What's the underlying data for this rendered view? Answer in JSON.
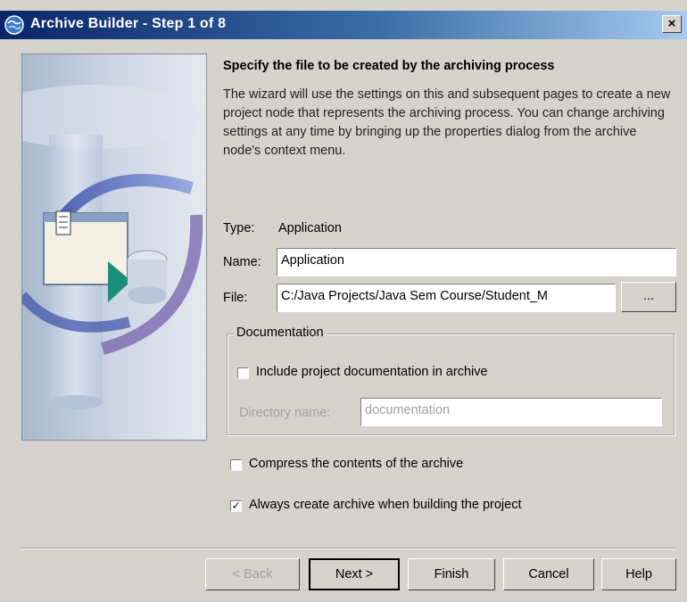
{
  "window": {
    "title": "Archive Builder - Step 1 of 8",
    "icon": "app-globe-icon",
    "close_symbol": "×"
  },
  "content": {
    "heading": "Specify the file to be created by the archiving process",
    "description": "The wizard will use the settings on this and subsequent pages to create a new project node that represents the archiving process. You can change archiving settings at any time by bringing up the properties dialog from the archive node's context menu."
  },
  "form": {
    "type_label": "Type:",
    "type_value": "Application",
    "name_label": "Name:",
    "name_value": "Application",
    "file_label": "File:",
    "file_value": "C:/Java Projects/Java Sem Course/Student_M",
    "browse_label": "..."
  },
  "documentation": {
    "group_title": "Documentation",
    "include_checkbox_label": "Include project documentation in archive",
    "include_checked": false,
    "directory_label": "Directory name:",
    "directory_value": "documentation"
  },
  "options": {
    "compress_label": "Compress the contents of the archive",
    "compress_checked": false,
    "always_create_label": "Always create archive when building the project",
    "always_create_checked": true
  },
  "buttons": {
    "back": "< Back",
    "next": "Next >",
    "finish": "Finish",
    "cancel": "Cancel",
    "help": "Help"
  },
  "colors": {
    "dialog_bg": "#d6d3ce",
    "titlebar_start": "#0a246a",
    "titlebar_end": "#a6caf0"
  }
}
